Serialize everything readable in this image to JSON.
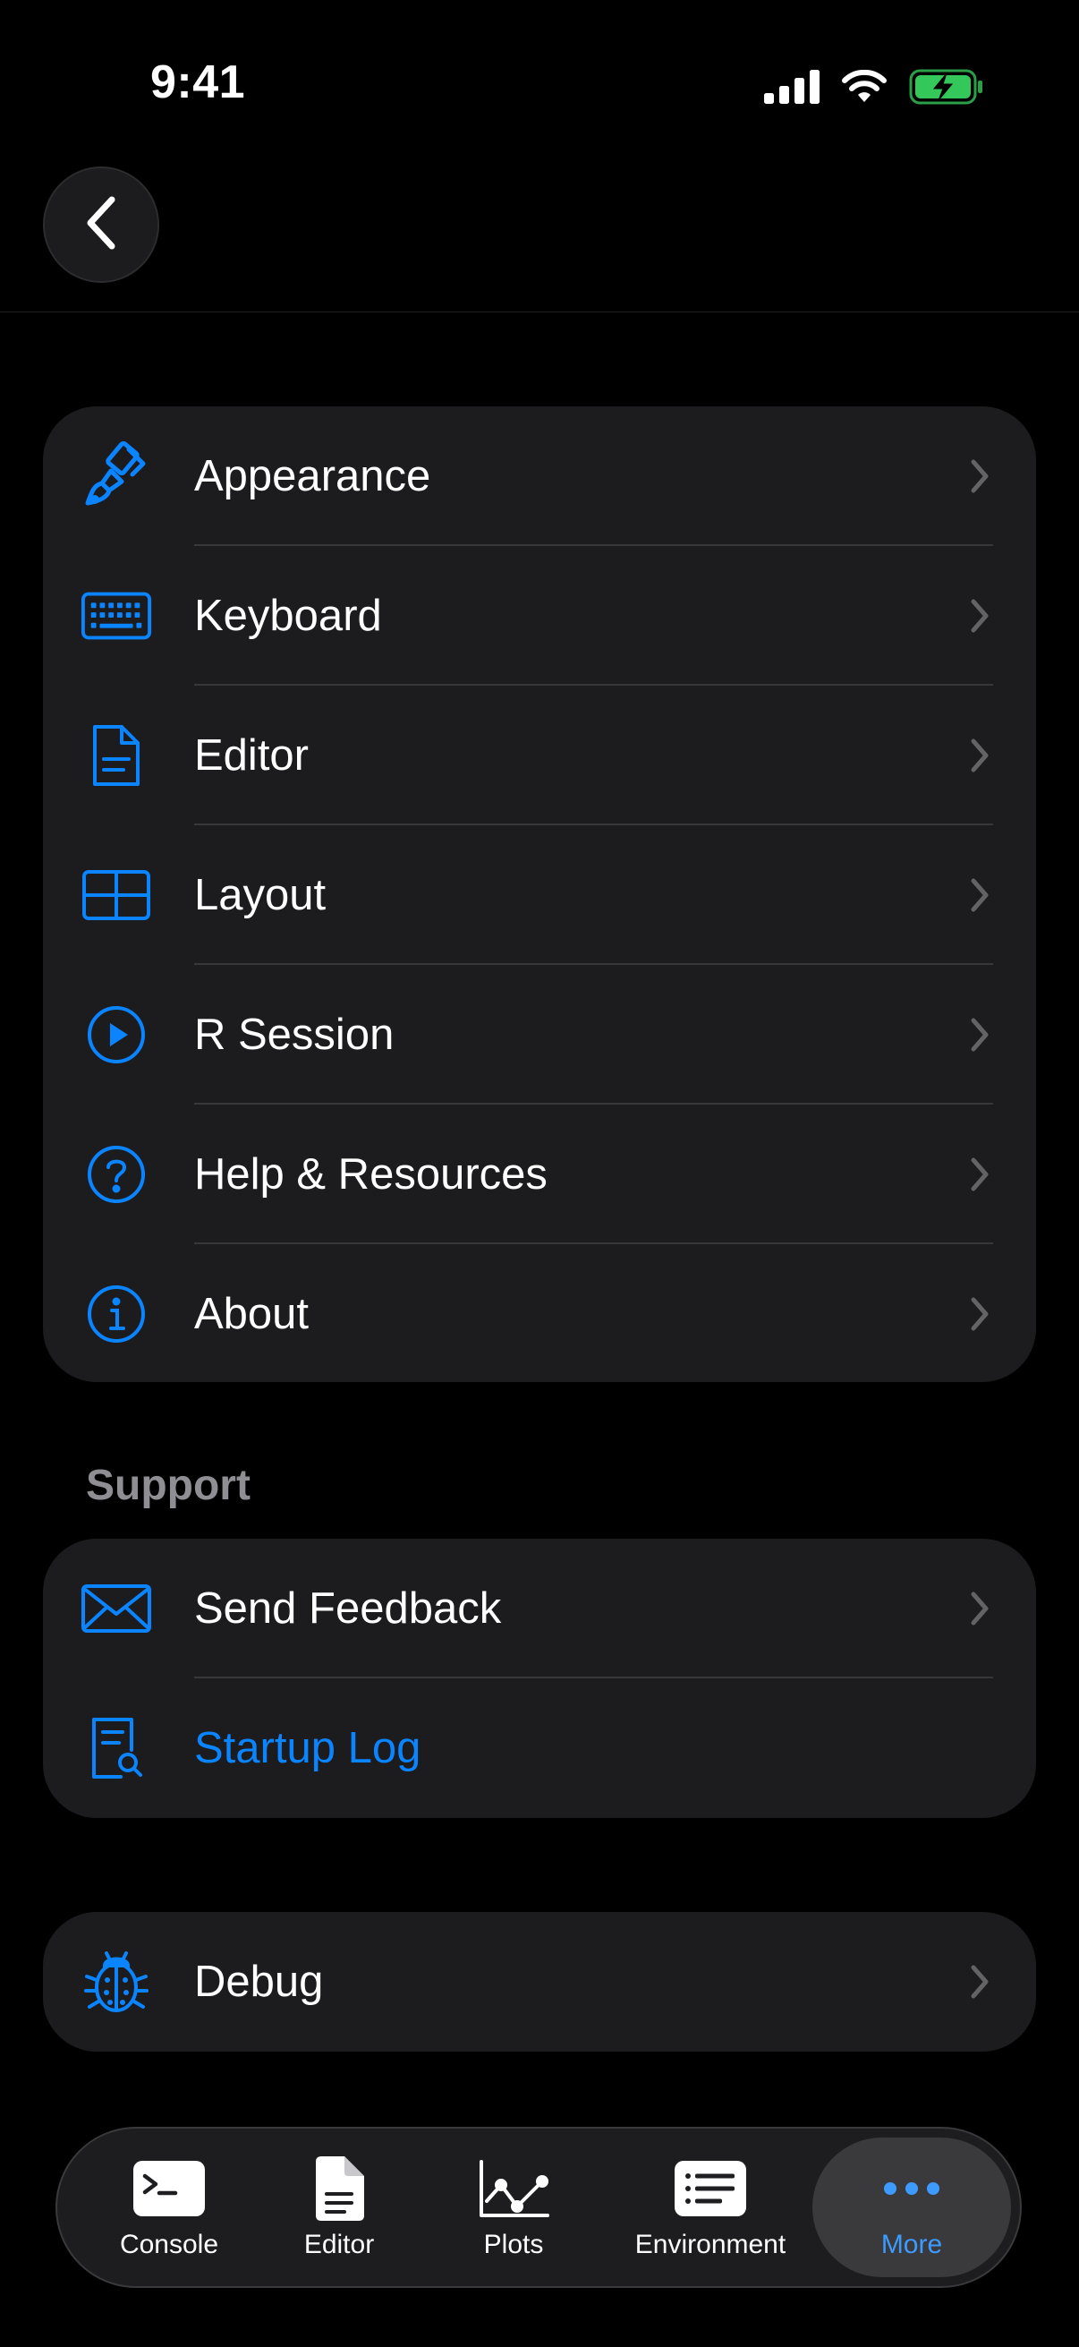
{
  "status_bar": {
    "time": "9:41"
  },
  "nav": {
    "back_icon": "chevron-left-icon"
  },
  "settings": {
    "items": [
      {
        "label": "Appearance",
        "icon": "paintbrush-icon"
      },
      {
        "label": "Keyboard",
        "icon": "keyboard-icon"
      },
      {
        "label": "Editor",
        "icon": "document-icon"
      },
      {
        "label": "Layout",
        "icon": "layout-grid-icon"
      },
      {
        "label": "R Session",
        "icon": "play-circle-icon"
      },
      {
        "label": "Help & Resources",
        "icon": "question-circle-icon"
      },
      {
        "label": "About",
        "icon": "info-circle-icon"
      }
    ]
  },
  "support": {
    "header": "Support",
    "items": [
      {
        "label": "Send Feedback",
        "icon": "envelope-icon"
      },
      {
        "label": "Startup Log",
        "icon": "document-search-icon"
      }
    ]
  },
  "debug": {
    "label": "Debug",
    "icon": "ladybug-icon"
  },
  "tab_bar": {
    "tabs": [
      {
        "label": "Console",
        "icon": "terminal-icon"
      },
      {
        "label": "Editor",
        "icon": "document-text-icon"
      },
      {
        "label": "Plots",
        "icon": "line-chart-icon"
      },
      {
        "label": "Environment",
        "icon": "list-icon"
      },
      {
        "label": "More",
        "icon": "ellipsis-icon",
        "active": true
      }
    ]
  },
  "colors": {
    "accent": "#0a84ff",
    "background": "#000000",
    "group_background": "#1c1c1e",
    "separator": "#38383a",
    "secondary_text": "#8e8e93",
    "battery": "#34c759"
  }
}
